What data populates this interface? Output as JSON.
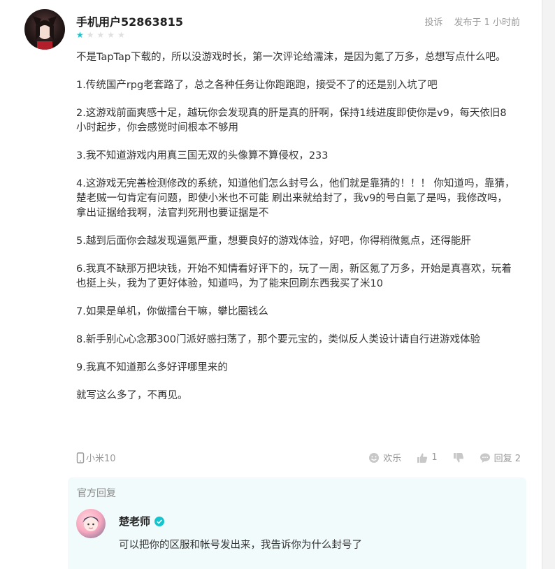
{
  "review": {
    "username": "手机用户52863815",
    "rating": 1,
    "rating_max": 5,
    "actions": {
      "report": "投诉",
      "posted": "发布于 1 小时前"
    },
    "paragraphs": [
      "不是TapTap下载的，所以没游戏时长，第一次评论给濡沫，是因为氪了万多，总想写点什么吧。",
      "1.传统国产rpg老套路了，总之各种任务让你跑跑跑，接受不了的还是别入坑了吧",
      "2.这游戏前面爽感十足，越玩你会发现真的肝是真的肝啊，保持1线进度即使你是v9，每天依旧8小时起步，你会感觉时间根本不够用",
      "3.我不知道游戏内用真三国无双的头像算不算侵权，233",
      "4.这游戏无完善检测修改的系统，知道他们怎么封号么，他们就是靠猜的！！！ 你知道吗，靠猜，楚老贼一句肯定有问题，即使小米也不可能 刷出来就给封了，我v9的号白氪了是吗，我修改吗，拿出证据给我啊，法官判死刑也要证据是不",
      "5.越到后面你会越发现逼氪严重，想要良好的游戏体验，好吧，你得稍微氪点，还得能肝",
      "6.我真不缺那万把块钱，开始不知情看好评下的，玩了一周，新区氪了万多，开始是真喜欢，玩着也挺上头，我为了更好体验，知道吗，为了能来回刷东西我买了米10",
      "7.如果是单机，你做擂台干嘛，攀比圈钱么",
      "8.新手别心心念那300门派好感扫荡了，那个要元宝的，类似反人类设计请自行进游戏体验",
      "9.我真不知道那么多好评哪里来的",
      "就写这么多了，不再见。"
    ],
    "footer": {
      "device": "小米10",
      "funny_label": "欢乐",
      "like_count": "1",
      "reply_label": "回复 2"
    }
  },
  "official_reply": {
    "heading": "官方回复",
    "author": "楚老师",
    "text": "可以把你的区服和帐号发出来，我告诉你为什么封号了"
  },
  "colors": {
    "accent": "#15c5ce",
    "muted": "#9a9a9a",
    "reply_bg": "#f2fbfc"
  }
}
